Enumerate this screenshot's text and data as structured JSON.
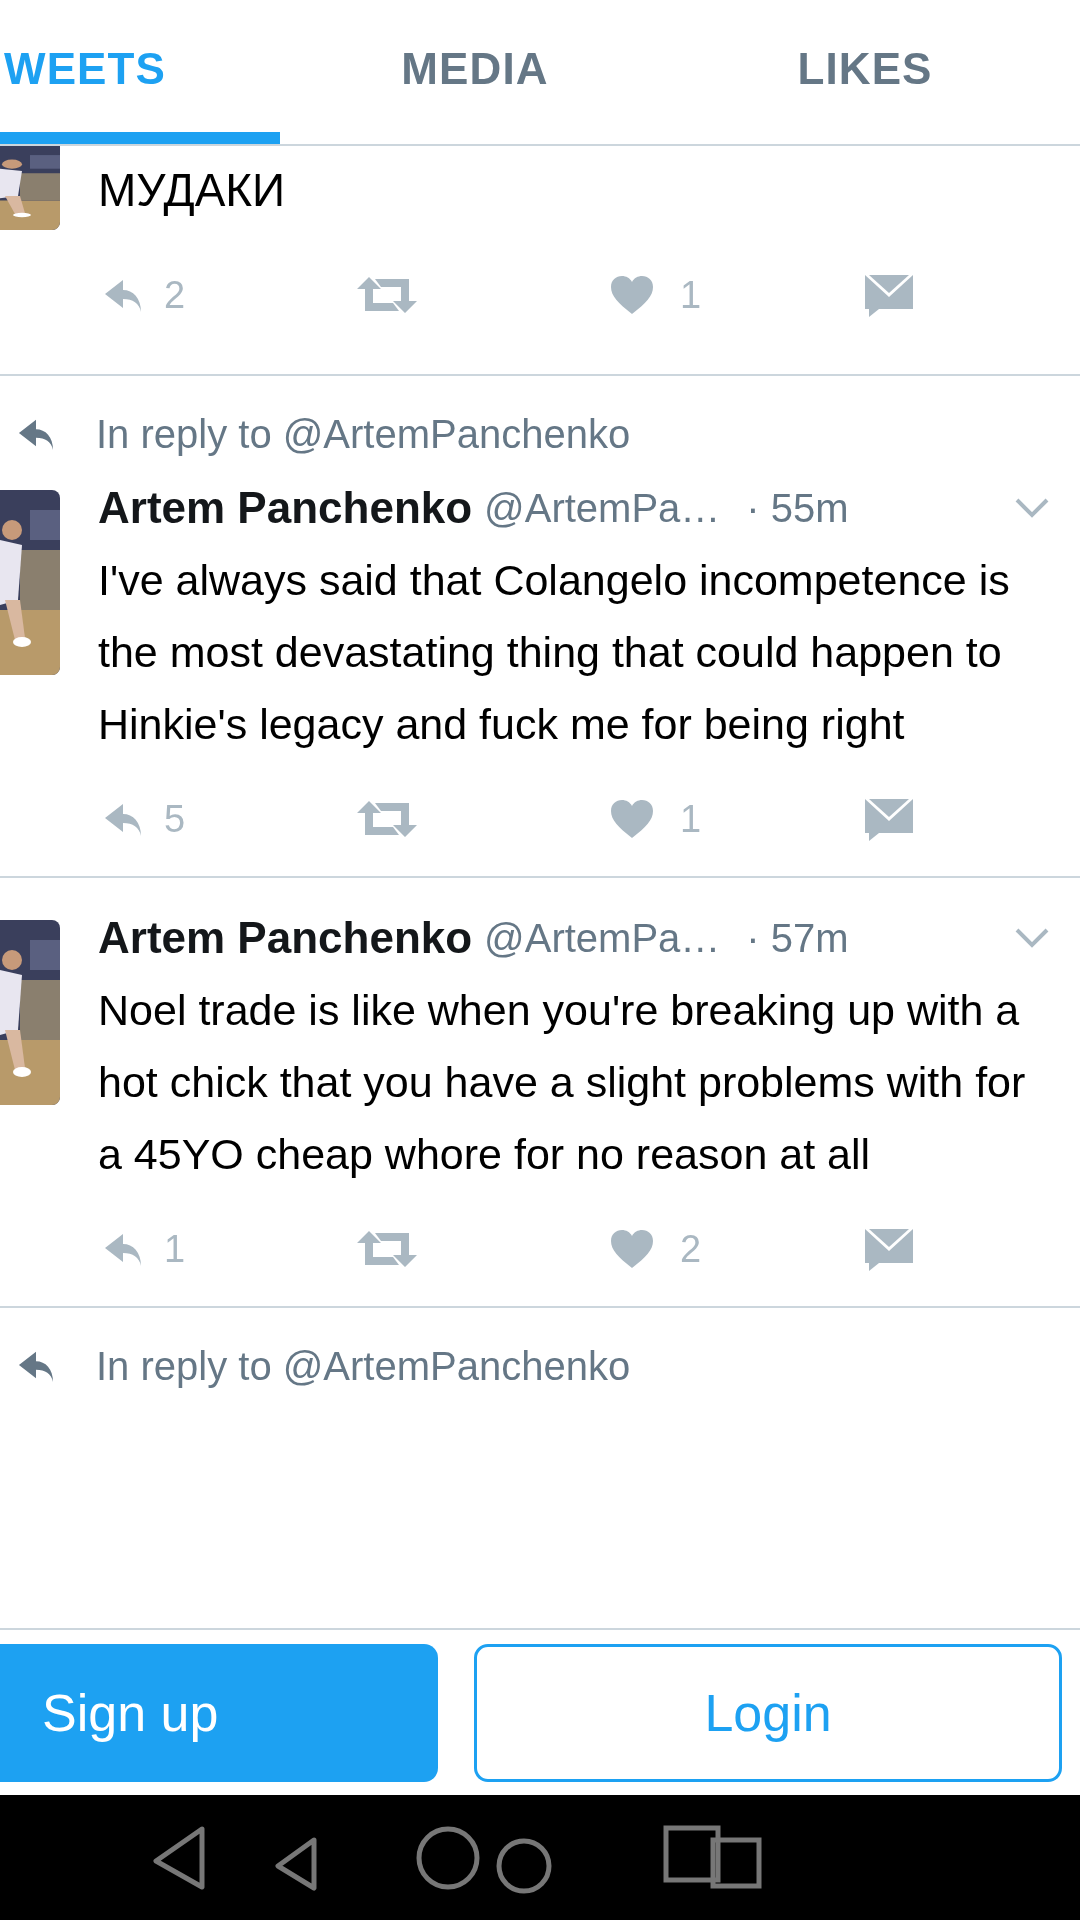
{
  "tabs": [
    {
      "label": "WEETS",
      "selected": true
    },
    {
      "label": "MEDIA",
      "selected": false
    },
    {
      "label": "LIKES",
      "selected": false
    }
  ],
  "tweets": [
    {
      "kind": "partial",
      "text": "МУДАКИ",
      "replies": "2",
      "likes": "1"
    },
    {
      "kind": "full",
      "in_reply_to": "In reply to @ArtemPanchenko",
      "name": "Artem Panchenko",
      "handle": "@ArtemPa…",
      "time": "· 55m",
      "text": "I've always said that Colangelo incompetence is the most devastating thing that could happen to Hinkie's legacy and fuck me for being right",
      "replies": "5",
      "likes": "1"
    },
    {
      "kind": "full",
      "name": "Artem Panchenko",
      "handle": "@ArtemPa…",
      "time": "· 57m",
      "text": "Noel trade is like when you're breaking up with a hot chick that you have a slight problems with for a 45YO cheap whore for no reason at all",
      "replies": "1",
      "likes": "2"
    },
    {
      "kind": "reply_only",
      "in_reply_to": "In reply to @ArtemPanchenko"
    }
  ],
  "buttons": {
    "signup": "Sign up",
    "login": "Login"
  }
}
